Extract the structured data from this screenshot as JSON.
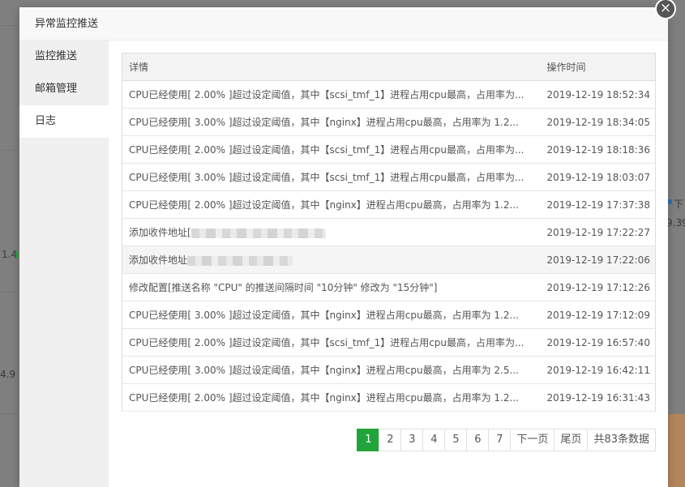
{
  "background": {
    "fragments": [
      "1.4",
      "4.9",
      "9.39",
      "下"
    ]
  },
  "modal": {
    "title": "异常监控推送",
    "close_label": "×"
  },
  "sidebar": {
    "items": [
      {
        "label": "监控推送",
        "active": false
      },
      {
        "label": "邮箱管理",
        "active": false
      },
      {
        "label": "日志",
        "active": true
      }
    ]
  },
  "table": {
    "headers": [
      "详情",
      "操作时间"
    ],
    "rows": [
      {
        "detail": "CPU已经使用[ 2.00% ]超过设定阈值，其中【scsi_tmf_1】进程占用cpu最高，占用率为...",
        "time": "2019-12-19 18:52:34",
        "redacted": false
      },
      {
        "detail": "CPU已经使用[ 3.00% ]超过设定阈值，其中【nginx】进程占用cpu最高，占用率为 1.2...",
        "time": "2019-12-19 18:34:05",
        "redacted": false
      },
      {
        "detail": "CPU已经使用[ 2.00% ]超过设定阈值，其中【scsi_tmf_1】进程占用cpu最高，占用率为...",
        "time": "2019-12-19 18:18:36",
        "redacted": false
      },
      {
        "detail": "CPU已经使用[ 3.00% ]超过设定阈值，其中【scsi_tmf_1】进程占用cpu最高，占用率为...",
        "time": "2019-12-19 18:03:07",
        "redacted": false
      },
      {
        "detail": "CPU已经使用[ 2.00% ]超过设定阈值，其中【nginx】进程占用cpu最高，占用率为 1.2...",
        "time": "2019-12-19 17:37:38",
        "redacted": false
      },
      {
        "detail": "添加收件地址[",
        "time": "2019-12-19 17:22:27",
        "redacted": true
      },
      {
        "detail": "添加收件地址",
        "time": "2019-12-19 17:22:06",
        "redacted": true
      },
      {
        "detail": "修改配置[推送名称 \"CPU\" 的推送间隔时间 \"10分钟\" 修改为 \"15分钟\"]",
        "time": "2019-12-19 17:12:26",
        "redacted": false
      },
      {
        "detail": "CPU已经使用[ 3.00% ]超过设定阈值，其中【nginx】进程占用cpu最高，占用率为 1.2...",
        "time": "2019-12-19 17:12:09",
        "redacted": false
      },
      {
        "detail": "CPU已经使用[ 2.00% ]超过设定阈值，其中【scsi_tmf_1】进程占用cpu最高，占用率为...",
        "time": "2019-12-19 16:57:40",
        "redacted": false
      },
      {
        "detail": "CPU已经使用[ 3.00% ]超过设定阈值，其中【nginx】进程占用cpu最高，占用率为 2.5...",
        "time": "2019-12-19 16:42:11",
        "redacted": false
      },
      {
        "detail": "CPU已经使用[ 2.00% ]超过设定阈值，其中【nginx】进程占用cpu最高，占用率为 1.2...",
        "time": "2019-12-19 16:31:43",
        "redacted": false
      }
    ]
  },
  "pagination": {
    "pages": [
      "1",
      "2",
      "3",
      "4",
      "5",
      "6",
      "7"
    ],
    "current": "1",
    "next_label": "下一页",
    "last_label": "尾页",
    "total_label": "共83条数据"
  },
  "colors": {
    "accent": "#20a53a"
  }
}
